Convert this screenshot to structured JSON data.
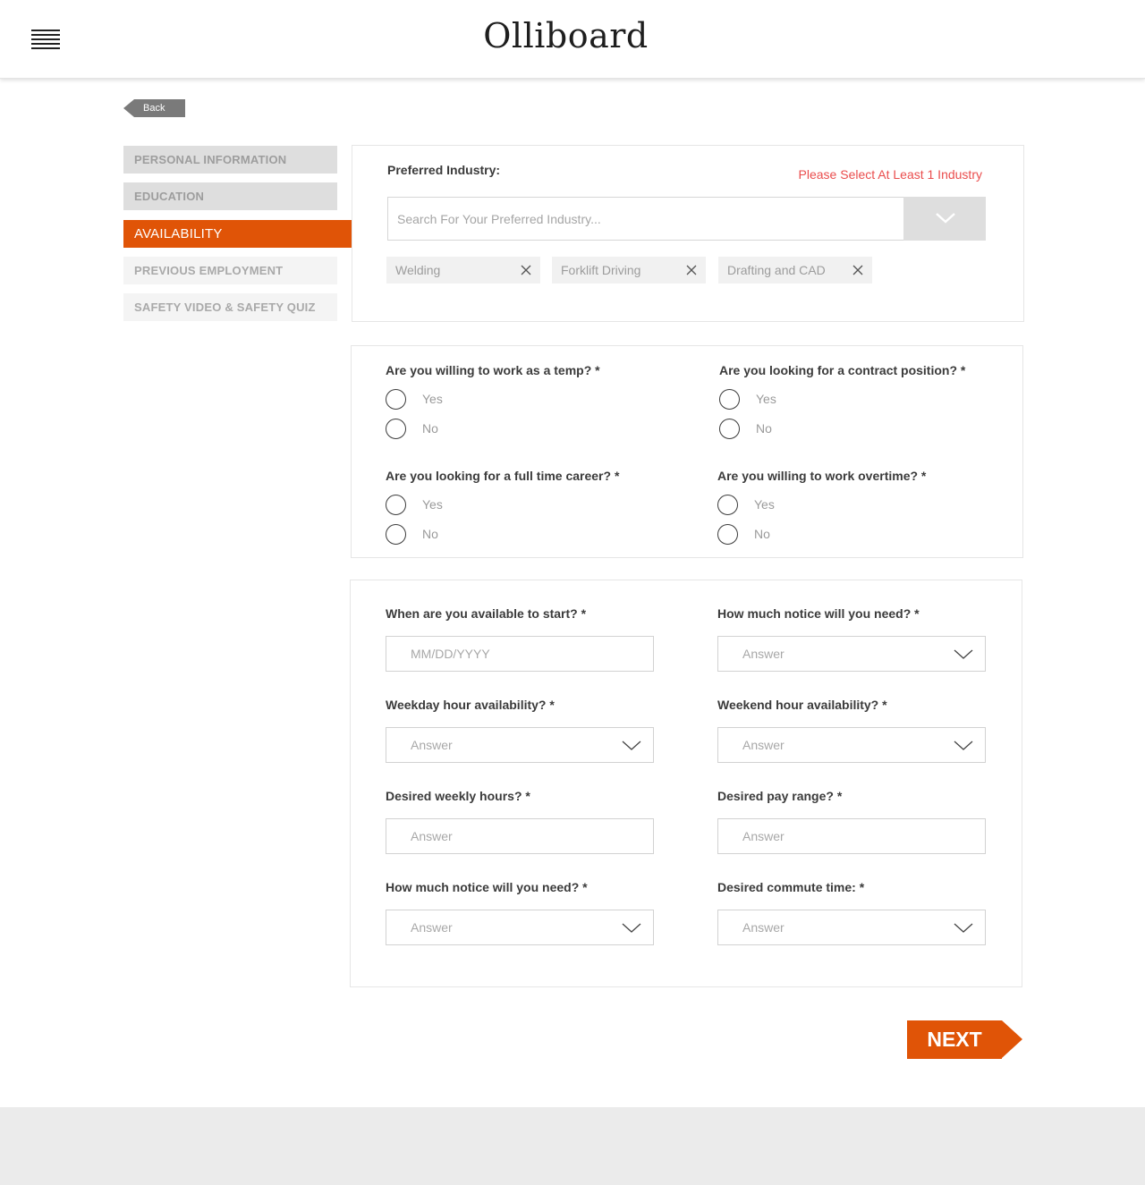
{
  "header": {
    "logo": "Olliboard",
    "menu_icon": "hamburger-menu-icon"
  },
  "back": {
    "label": "Back"
  },
  "sidebar": {
    "items": [
      {
        "label": "PERSONAL INFORMATION",
        "state": "done"
      },
      {
        "label": "EDUCATION",
        "state": "done"
      },
      {
        "label": "AVAILABILITY",
        "state": "active"
      },
      {
        "label": "PREVIOUS EMPLOYMENT",
        "state": "pending"
      },
      {
        "label": "SAFETY VIDEO & SAFETY QUIZ",
        "state": "pending"
      }
    ]
  },
  "industry": {
    "label": "Preferred Industry:",
    "error": "Please Select At Least 1 Industry",
    "search_placeholder": "Search For Your Preferred Industry...",
    "tags": [
      "Welding",
      "Forklift Driving",
      "Drafting and CAD"
    ]
  },
  "questions": {
    "temp": {
      "label": "Are you willing to work as a temp? *",
      "yes": "Yes",
      "no": "No"
    },
    "contract": {
      "label": "Are you looking for a contract position? *",
      "yes": "Yes",
      "no": "No"
    },
    "fulltime": {
      "label": "Are you looking for a full time career? *",
      "yes": "Yes",
      "no": "No"
    },
    "overtime": {
      "label": "Are you willing to work overtime? *",
      "yes": "Yes",
      "no": "No"
    }
  },
  "fields": {
    "start": {
      "label": "When are you available to start? *",
      "placeholder": "MM/DD/YYYY"
    },
    "notice1": {
      "label": "How much notice will you need? *",
      "value": "Answer"
    },
    "weekday": {
      "label": "Weekday hour availability? *",
      "value": "Answer"
    },
    "weekend": {
      "label": "Weekend hour availability? *",
      "value": "Answer"
    },
    "weekly_hours": {
      "label": "Desired weekly hours? *",
      "placeholder": "Answer"
    },
    "pay": {
      "label": "Desired pay range? *",
      "placeholder": "Answer"
    },
    "notice2": {
      "label": "How much notice will you need? *",
      "value": "Answer"
    },
    "commute": {
      "label": "Desired commute time: *",
      "value": "Answer"
    }
  },
  "next": {
    "label": "NEXT"
  },
  "colors": {
    "accent": "#e05407",
    "error": "#ea4d4d"
  }
}
